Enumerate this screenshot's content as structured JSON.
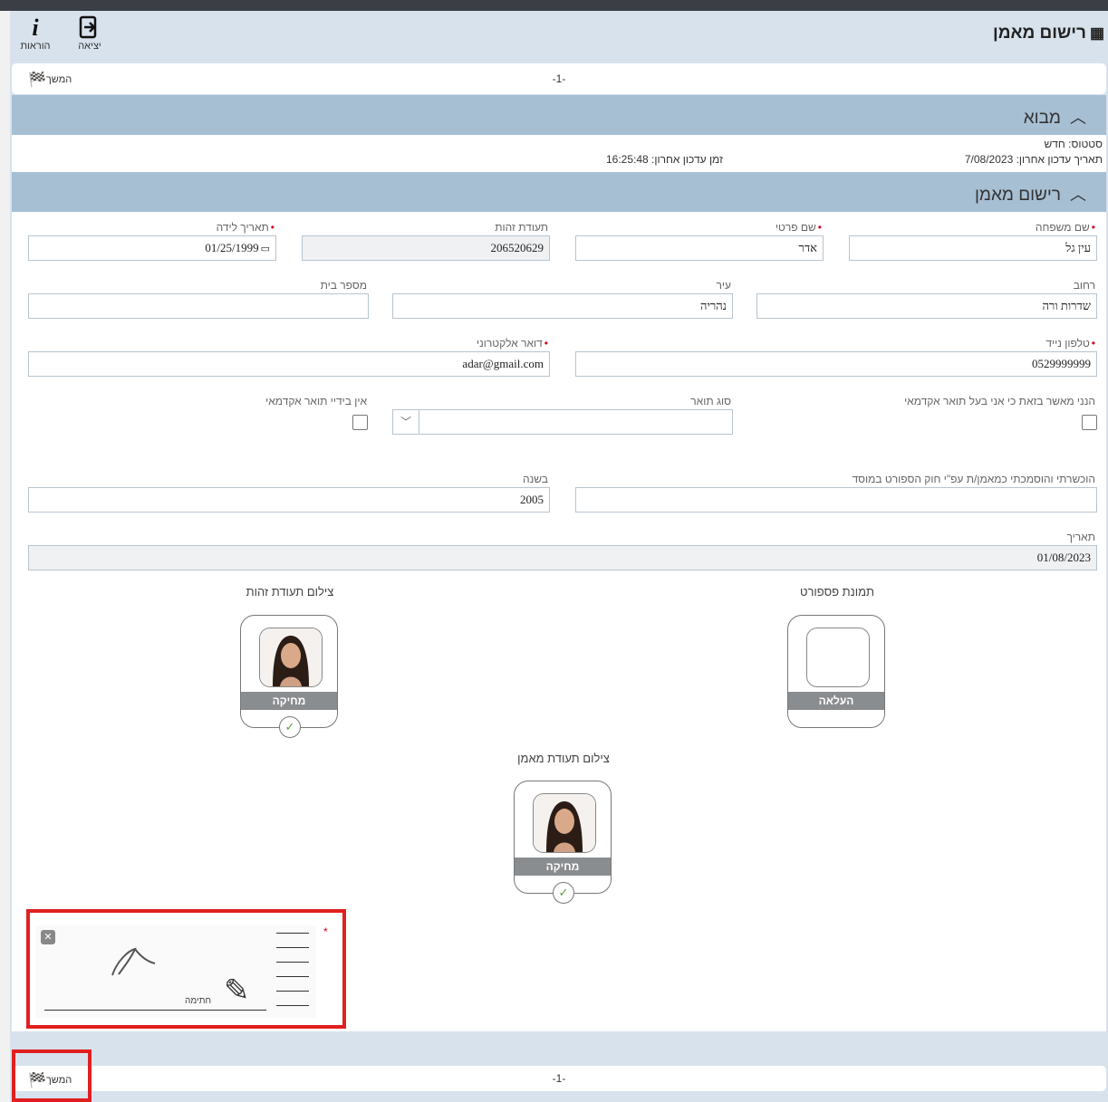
{
  "toolbar": {
    "instructions_label": "הוראות",
    "instructions_icon": "info-icon",
    "exit_label": "יציאה",
    "exit_icon": "exit-icon"
  },
  "page": {
    "title": "רישום מאמן",
    "title_icon": "register-icon"
  },
  "nav": {
    "continue_label": "המשך",
    "continue_icon": "checkered-flag-icon",
    "page_indicator": "-1-"
  },
  "intro": {
    "section_title": "מבוא",
    "status": "סטטוס: חדש",
    "last_update_date": "תאריך עדכון אחרון: 7/08/2023",
    "last_update_time": "זמן עדכון אחרון: 16:25:48"
  },
  "registration": {
    "section_title": "רישום מאמן",
    "fields": {
      "last_name": {
        "label": "שם משפחה",
        "value": "עין גל"
      },
      "first_name": {
        "label": "שם פרטי",
        "value": "אדר"
      },
      "id_number": {
        "label": "תעודת זהות",
        "value": "206520629"
      },
      "birth_date": {
        "label": "תאריך לידה",
        "value": "01/25/1999"
      },
      "street": {
        "label": "רחוב",
        "value": "שדרות ורה"
      },
      "city": {
        "label": "עיר",
        "value": "נהריה"
      },
      "house_number": {
        "label": "מספר בית",
        "value": ""
      },
      "mobile_phone": {
        "label": "טלפון נייד",
        "value": "0529999999"
      },
      "email": {
        "label": "דואר אלקטרוני",
        "value": "adar@gmail.com"
      },
      "academic_confirm": {
        "label": "הנני מאשר בזאת כי אני בעל תואר אקדמאי"
      },
      "degree_type": {
        "label": "סוג תואר",
        "value": ""
      },
      "no_degree": {
        "label": "אין בידיי תואר אקדמאי"
      },
      "certification": {
        "label": "הוכשרתי והוסמכתי כמאמן/ת עפ\"י חוק הספורט במוסד",
        "value": ""
      },
      "year": {
        "label": "בשנה",
        "value": "2005"
      },
      "date": {
        "label": "תאריך",
        "value": "01/08/2023"
      }
    },
    "uploads": {
      "passport_photo": {
        "title": "תמונת פספורט",
        "action": "העלאה"
      },
      "id_photo": {
        "title": "צילום תעודת זהות",
        "action": "מחיקה"
      },
      "trainer_cert_photo": {
        "title": "צילום תעודת מאמן",
        "action": "מחיקה"
      }
    },
    "signature": {
      "caption": "חתימה",
      "clear_icon": "close-icon",
      "pencil_icon": "pencil-icon",
      "required_mark": "*"
    }
  }
}
